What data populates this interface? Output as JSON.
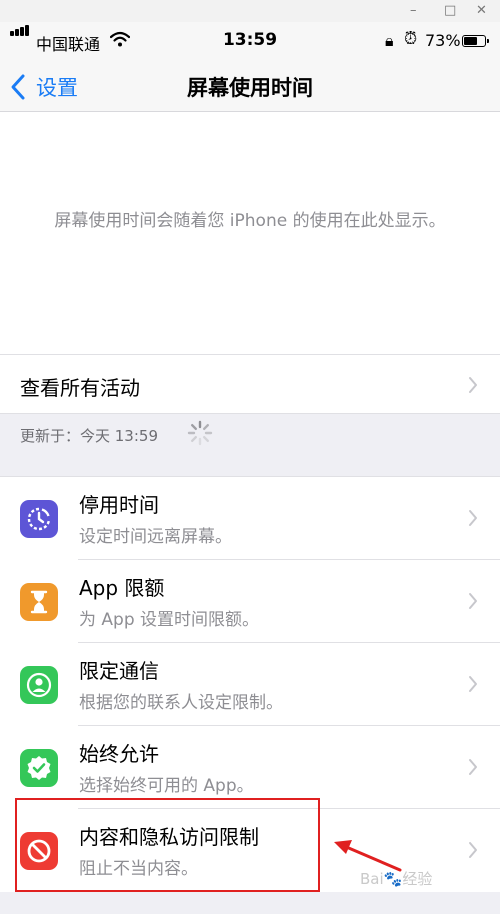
{
  "window": {
    "minimize": "–",
    "maximize": "□",
    "close": "✕"
  },
  "status": {
    "carrier": "中国联通",
    "time": "13:59",
    "battery": "73%",
    "battery_level": 0.73
  },
  "nav": {
    "back_label": "设置",
    "title": "屏幕使用时间"
  },
  "info": {
    "text": "屏幕使用时间会随着您 iPhone 的使用在此处显示。"
  },
  "view_all": {
    "label": "查看所有活动"
  },
  "updated": {
    "text": "更新于：今天 13:59"
  },
  "items": [
    {
      "title": "停用时间",
      "subtitle": "设定时间远离屏幕。",
      "icon": "downtime-icon",
      "color": "#5d55d6"
    },
    {
      "title": "App 限额",
      "subtitle": "为 App 设置时间限额。",
      "icon": "hourglass-icon",
      "color": "#f0992c"
    },
    {
      "title": "限定通信",
      "subtitle": "根据您的联系人设定限制。",
      "icon": "contact-icon",
      "color": "#34c759"
    },
    {
      "title": "始终允许",
      "subtitle": "选择始终可用的 App。",
      "icon": "checkmark-badge-icon",
      "color": "#34c759"
    },
    {
      "title": "内容和隐私访问限制",
      "subtitle": "阻止不当内容。",
      "icon": "no-entry-icon",
      "color": "#ee3b33"
    }
  ],
  "watermark": {
    "text": "Bai🐾经验"
  }
}
